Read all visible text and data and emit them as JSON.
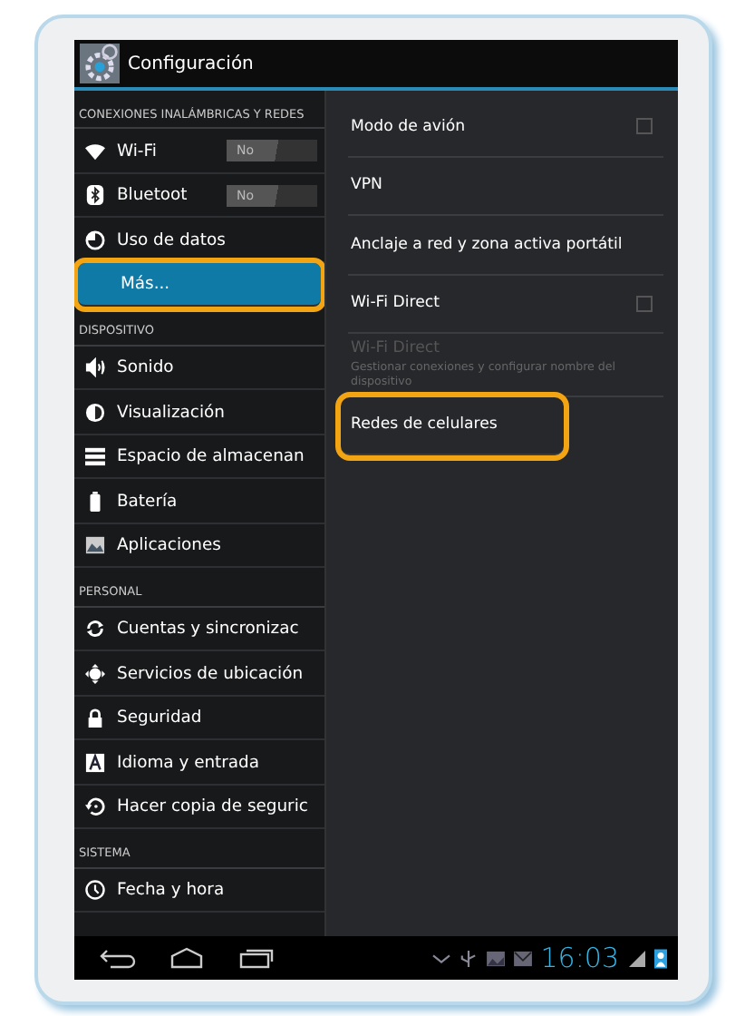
{
  "title_bar": {
    "title": "Configuración"
  },
  "sidebar": {
    "sections": [
      {
        "header": "CONEXIONES INALÁMBRICAS Y REDES",
        "items": [
          {
            "label": "Wi-Fi",
            "selected": false,
            "highlighted": false,
            "toggle": {
              "label": "No",
              "on": false
            }
          },
          {
            "label": "Bluetoot",
            "selected": false,
            "highlighted": false,
            "toggle": {
              "label": "No",
              "on": false
            }
          },
          {
            "label": "Uso de datos",
            "selected": false,
            "highlighted": false
          },
          {
            "label": "Más...",
            "selected": true,
            "highlighted": true
          }
        ]
      },
      {
        "header": "DISPOSITIVO",
        "items": [
          {
            "label": "Sonido",
            "selected": false,
            "highlighted": false
          },
          {
            "label": "Visualización",
            "selected": false,
            "highlighted": false
          },
          {
            "label": "Espacio de almacenan",
            "selected": false,
            "highlighted": false
          },
          {
            "label": "Batería",
            "selected": false,
            "highlighted": false
          },
          {
            "label": "Aplicaciones",
            "selected": false,
            "highlighted": false
          }
        ]
      },
      {
        "header": "PERSONAL",
        "items": [
          {
            "label": "Cuentas y sincronizac",
            "selected": false,
            "highlighted": false
          },
          {
            "label": "Servicios de ubicación",
            "selected": false,
            "highlighted": false
          },
          {
            "label": "Seguridad",
            "selected": false,
            "highlighted": false
          },
          {
            "label": "Idioma y entrada",
            "selected": false,
            "highlighted": false
          },
          {
            "label": "Hacer copia de seguric",
            "selected": false,
            "highlighted": false
          }
        ]
      },
      {
        "header": "SISTEMA",
        "items": [
          {
            "label": "Fecha y hora",
            "selected": false,
            "highlighted": false
          }
        ]
      }
    ]
  },
  "settings": [
    {
      "kind": "checkbox",
      "title": "Modo de avión",
      "checked": false,
      "disabled": false,
      "highlighted": false
    },
    {
      "kind": "link",
      "title": "VPN",
      "disabled": false,
      "highlighted": false
    },
    {
      "kind": "link",
      "title": "Anclaje a red y zona activa portátil",
      "disabled": false,
      "highlighted": false
    },
    {
      "kind": "checkbox",
      "title": "Wi-Fi Direct",
      "checked": false,
      "disabled": false,
      "highlighted": false
    },
    {
      "kind": "link",
      "title": "Wi-Fi Direct",
      "summary": "Gestionar conexiones y configurar nombre del dispositivo",
      "disabled": true,
      "highlighted": false
    },
    {
      "kind": "link",
      "title": "Redes de celulares",
      "disabled": false,
      "highlighted": true
    }
  ],
  "status_bar": {
    "time": "16:03"
  }
}
